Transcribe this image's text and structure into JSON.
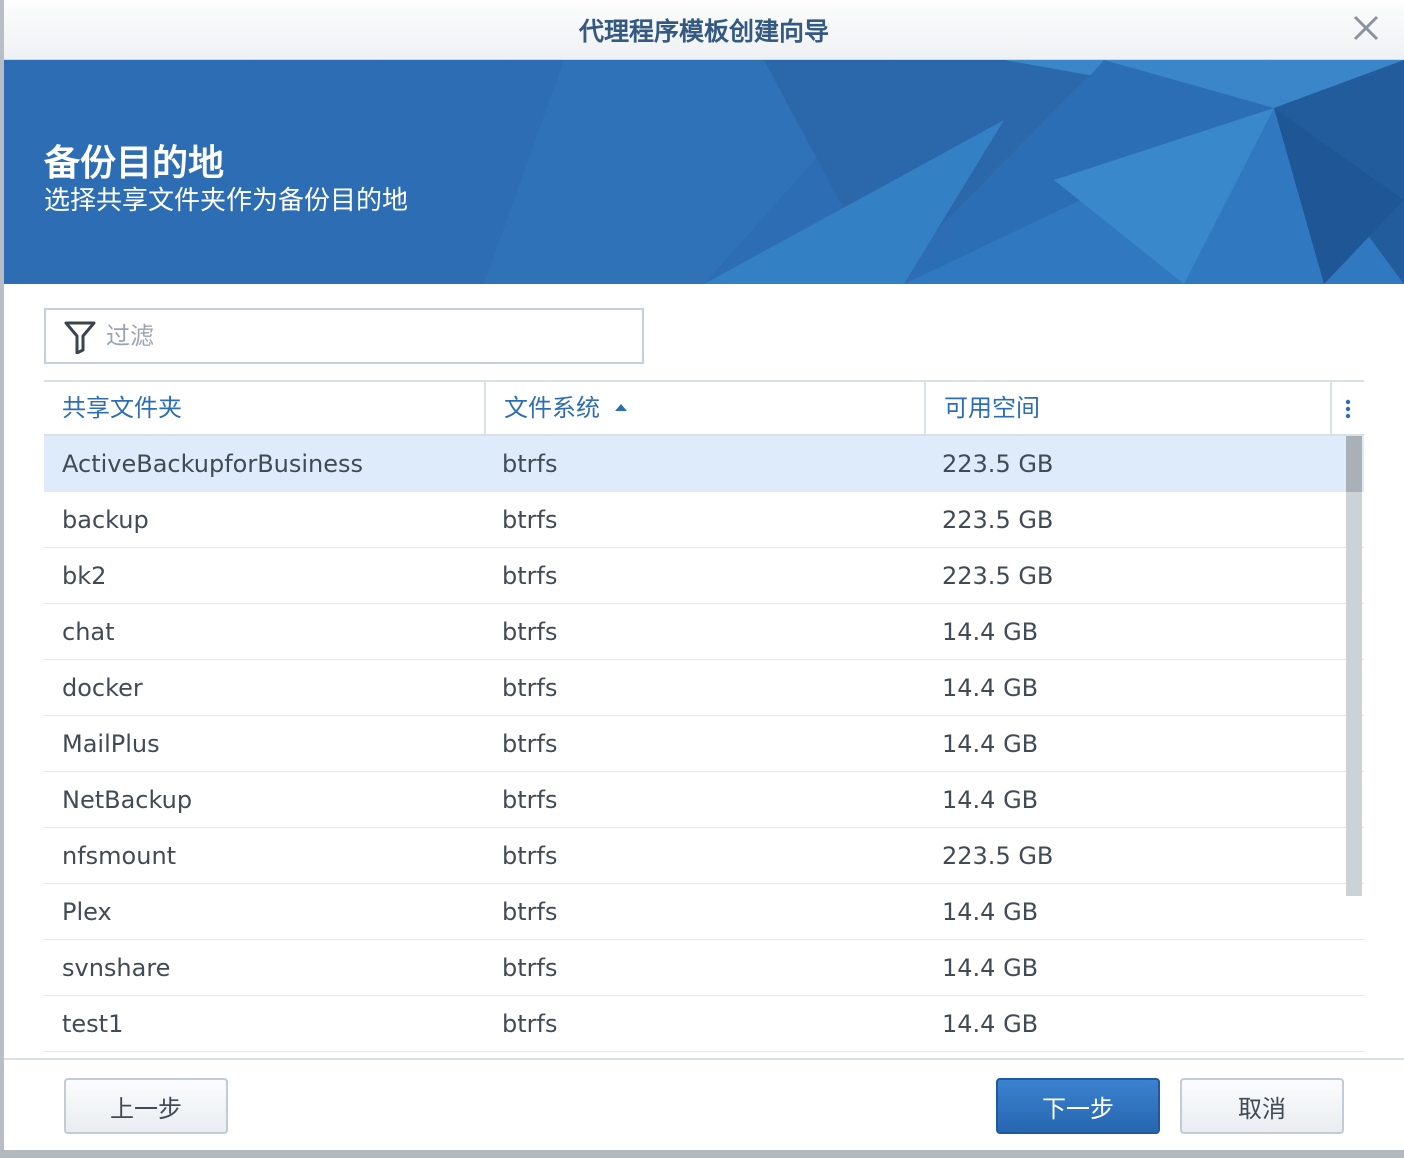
{
  "window": {
    "title": "代理程序模板创建向导",
    "close_icon": "close-icon"
  },
  "banner": {
    "title": "备份目的地",
    "subtitle": "选择共享文件夹作为备份目的地",
    "color": "#2d6db3"
  },
  "filter": {
    "placeholder": "过滤",
    "value": "",
    "icon": "filter-icon"
  },
  "table": {
    "columns": [
      {
        "label": "共享文件夹"
      },
      {
        "label": "文件系统",
        "sort": "ascending"
      },
      {
        "label": "可用空间"
      }
    ],
    "rows": [
      {
        "name": "ActiveBackupforBusiness",
        "fs": "btrfs",
        "space": "223.5 GB",
        "selected": true
      },
      {
        "name": "backup",
        "fs": "btrfs",
        "space": "223.5 GB"
      },
      {
        "name": "bk2",
        "fs": "btrfs",
        "space": "223.5 GB"
      },
      {
        "name": "chat",
        "fs": "btrfs",
        "space": "14.4 GB"
      },
      {
        "name": "docker",
        "fs": "btrfs",
        "space": "14.4 GB"
      },
      {
        "name": "MailPlus",
        "fs": "btrfs",
        "space": "14.4 GB"
      },
      {
        "name": "NetBackup",
        "fs": "btrfs",
        "space": "14.4 GB"
      },
      {
        "name": "nfsmount",
        "fs": "btrfs",
        "space": "223.5 GB"
      },
      {
        "name": "Plex",
        "fs": "btrfs",
        "space": "14.4 GB"
      },
      {
        "name": "svnshare",
        "fs": "btrfs",
        "space": "14.4 GB"
      },
      {
        "name": "test1",
        "fs": "btrfs",
        "space": "14.4 GB"
      }
    ]
  },
  "footer": {
    "prev_label": "上一步",
    "next_label": "下一步",
    "cancel_label": "取消"
  },
  "colors": {
    "accent": "#2d6db3",
    "selected_row": "#deebfa",
    "primary_button": "#2766b0"
  }
}
